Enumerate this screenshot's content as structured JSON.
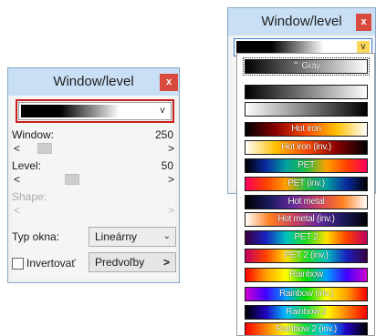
{
  "left_window": {
    "title": "Window/level",
    "close_label": "x",
    "window_label": "Window:",
    "window_value": "250",
    "level_label": "Level:",
    "level_value": "50",
    "shape_label": "Shape:",
    "window_slider_fraction": 0.12,
    "level_slider_fraction": 0.32,
    "scroll_left": "<",
    "scroll_right": ">",
    "typ_okna_label": "Typ okna:",
    "typ_okna_value": "Lineárny",
    "invertovat_label": "Invertovať",
    "invertovat_checked": false,
    "predvolby_label": "Predvoľby",
    "predvolby_arrow": ">",
    "chevron": "⌄",
    "combo_arrow": "v"
  },
  "right_window": {
    "title": "Window/level",
    "close_label": "x",
    "combo_arrow": "v"
  },
  "lut_list": [
    {
      "label": "Gray",
      "gradient": "linear-gradient(to right,#000,#fff)"
    },
    {
      "label": "",
      "gradient": "linear-gradient(to right,#000,#fff)"
    },
    {
      "label": "",
      "gradient": "linear-gradient(to right,#fff,#000)"
    },
    {
      "label": "Hot iron",
      "gradient": "linear-gradient(to right,#000,#8a0000,#ff4a00,#ffc000,#fff)"
    },
    {
      "label": "Hot iron (inv.)",
      "gradient": "linear-gradient(to right,#fff,#ffc000,#ff4a00,#8a0000,#000)"
    },
    {
      "label": "PET",
      "gradient": "linear-gradient(to right,#000,#0a2aa0,#00a0a0,#20c040,#ffa000,#ff4000,#ff0060)"
    },
    {
      "label": "PET (inv.)",
      "gradient": "linear-gradient(to right,#ff0060,#ff4000,#ffa000,#20c040,#00a0a0,#0a2aa0,#000)"
    },
    {
      "label": "Hot metal",
      "gradient": "linear-gradient(to right,#000,#1a1a60,#6a2aa0,#d04060,#ff8020,#fff)"
    },
    {
      "label": "Hot metal (inv.)",
      "gradient": "linear-gradient(to right,#fff,#ff8020,#d04060,#6a2aa0,#1a1a60,#000)"
    },
    {
      "label": "PET 2",
      "gradient": "linear-gradient(to right,#3a0040,#1a20c0,#00c0c0,#20e020,#ffe000,#ff4000,#c00060)"
    },
    {
      "label": "PET 2 (inv.)",
      "gradient": "linear-gradient(to right,#c00060,#ff4000,#ffe000,#20e020,#00c0c0,#1a20c0,#3a0040)"
    },
    {
      "label": "Rainbow",
      "gradient": "linear-gradient(to right,#ff0000,#ffa000,#ffff00,#00e000,#00a0ff,#4000ff,#d000d0)"
    },
    {
      "label": "Rainbow (inv.)",
      "gradient": "linear-gradient(to right,#d000d0,#4000ff,#00a0ff,#00e000,#ffff00,#ffa000,#ff0000)"
    },
    {
      "label": "Rainbow 2",
      "gradient": "linear-gradient(to right,#000,#2000c0,#00c0ff,#00e040,#ffff00,#ff8000,#ff0000)"
    },
    {
      "label": "Rainbow 2 (inv.)",
      "gradient": "linear-gradient(to right,#ff0000,#ff8000,#ffff00,#00e040,#00c0ff,#2000c0,#000)"
    }
  ],
  "lut_selected_index": 0,
  "lut_first_prefix": "⌃"
}
